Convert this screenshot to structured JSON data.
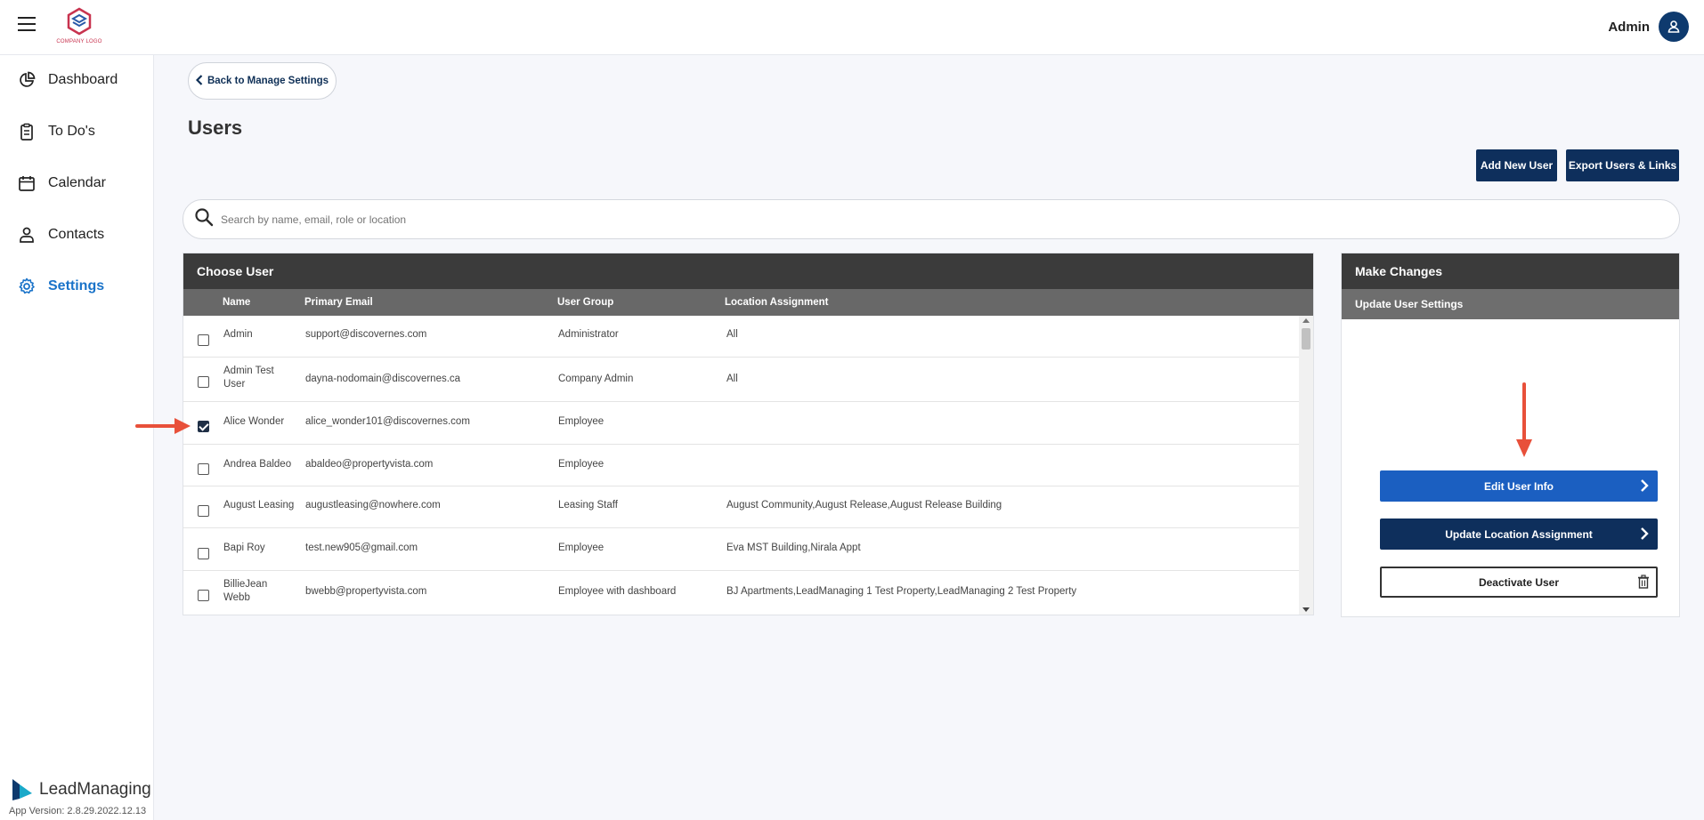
{
  "header": {
    "logo_text": "COMPANY LOGO",
    "user_name": "Admin"
  },
  "sidebar": {
    "items": [
      {
        "label": "Dashboard",
        "icon": "pie-chart-icon"
      },
      {
        "label": "To Do's",
        "icon": "clipboard-icon"
      },
      {
        "label": "Calendar",
        "icon": "calendar-icon"
      },
      {
        "label": "Contacts",
        "icon": "contacts-icon"
      },
      {
        "label": "Settings",
        "icon": "gear-icon",
        "active": true
      }
    ],
    "brand": "LeadManaging",
    "app_version": "App Version: 2.8.29.2022.12.13"
  },
  "main": {
    "back_label": "Back to Manage Settings",
    "title": "Users",
    "add_user_label": "Add New User",
    "export_label": "Export Users & Links",
    "search_placeholder": "Search by name, email, role or location"
  },
  "choose_user": {
    "title": "Choose User",
    "columns": [
      "Name",
      "Primary Email",
      "User Group",
      "Location Assignment"
    ],
    "rows": [
      {
        "name": "Admin",
        "email": "support@discovernes.com",
        "group": "Administrator",
        "location": "All",
        "checked": false
      },
      {
        "name": "Admin Test User",
        "email": "dayna-nodomain@discovernes.ca",
        "group": "Company Admin",
        "location": "All",
        "checked": false
      },
      {
        "name": "Alice Wonder",
        "email": "alice_wonder101@discovernes.com",
        "group": "Employee",
        "location": "",
        "checked": true
      },
      {
        "name": "Andrea Baldeo",
        "email": "abaldeo@propertyvista.com",
        "group": "Employee",
        "location": "",
        "checked": false
      },
      {
        "name": "August Leasing",
        "email": "augustleasing@nowhere.com",
        "group": "Leasing Staff",
        "location": "August Community,August Release,August Release Building",
        "checked": false
      },
      {
        "name": "Bapi Roy",
        "email": "test.new905@gmail.com",
        "group": "Employee",
        "location": "Eva MST Building,Nirala Appt",
        "checked": false
      },
      {
        "name": "BillieJean Webb",
        "email": "bwebb@propertyvista.com",
        "group": "Employee with dashboard",
        "location": "BJ Apartments,LeadManaging 1 Test Property,LeadManaging 2 Test Property",
        "checked": false
      }
    ]
  },
  "make_changes": {
    "title": "Make Changes",
    "subtitle": "Update User Settings",
    "edit_label": "Edit User Info",
    "location_label": "Update Location Assignment",
    "deactivate_label": "Deactivate User"
  },
  "colors": {
    "navy": "#0e2f5c",
    "blue": "#1b5fc1",
    "active_nav": "#1a73c9",
    "annotation_arrow": "#e8503a"
  }
}
